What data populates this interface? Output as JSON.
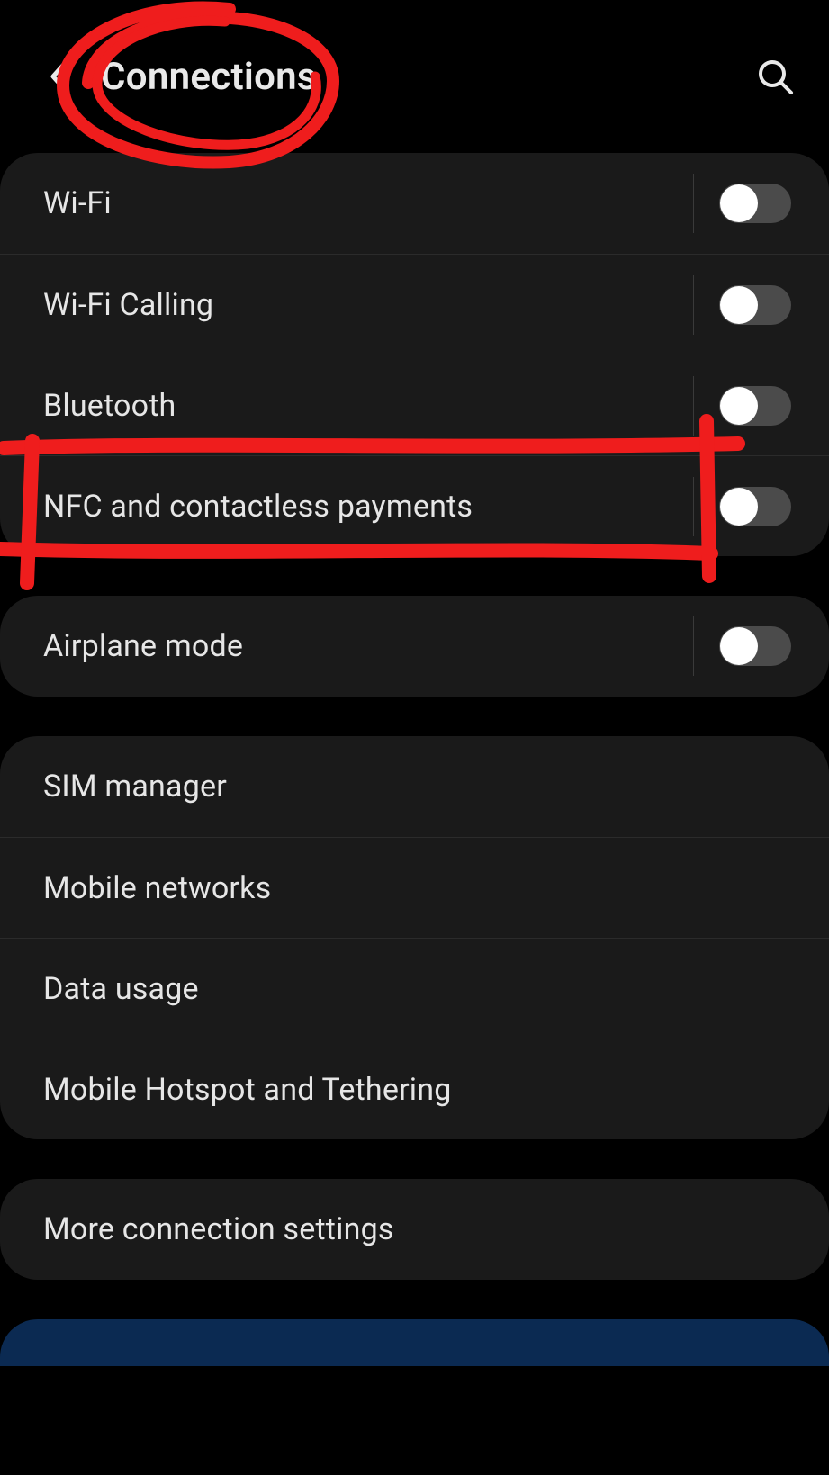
{
  "header": {
    "title": "Connections",
    "back_icon": "chevron-left",
    "search_icon": "search"
  },
  "groups": [
    {
      "items": [
        {
          "label": "Wi-Fi",
          "toggle": false
        },
        {
          "label": "Wi-Fi Calling",
          "toggle": false
        },
        {
          "label": "Bluetooth",
          "toggle": false
        },
        {
          "label": "NFC and contactless payments",
          "toggle": false
        }
      ]
    },
    {
      "items": [
        {
          "label": "Airplane mode",
          "toggle": false
        }
      ]
    },
    {
      "items": [
        {
          "label": "SIM manager"
        },
        {
          "label": "Mobile networks"
        },
        {
          "label": "Data usage"
        },
        {
          "label": "Mobile Hotspot and Tethering"
        }
      ]
    },
    {
      "items": [
        {
          "label": "More connection settings"
        }
      ]
    }
  ],
  "annotations": {
    "circle_target": "Connections",
    "box_target": "NFC and contactless payments",
    "stroke_color": "#ef1d1d"
  }
}
